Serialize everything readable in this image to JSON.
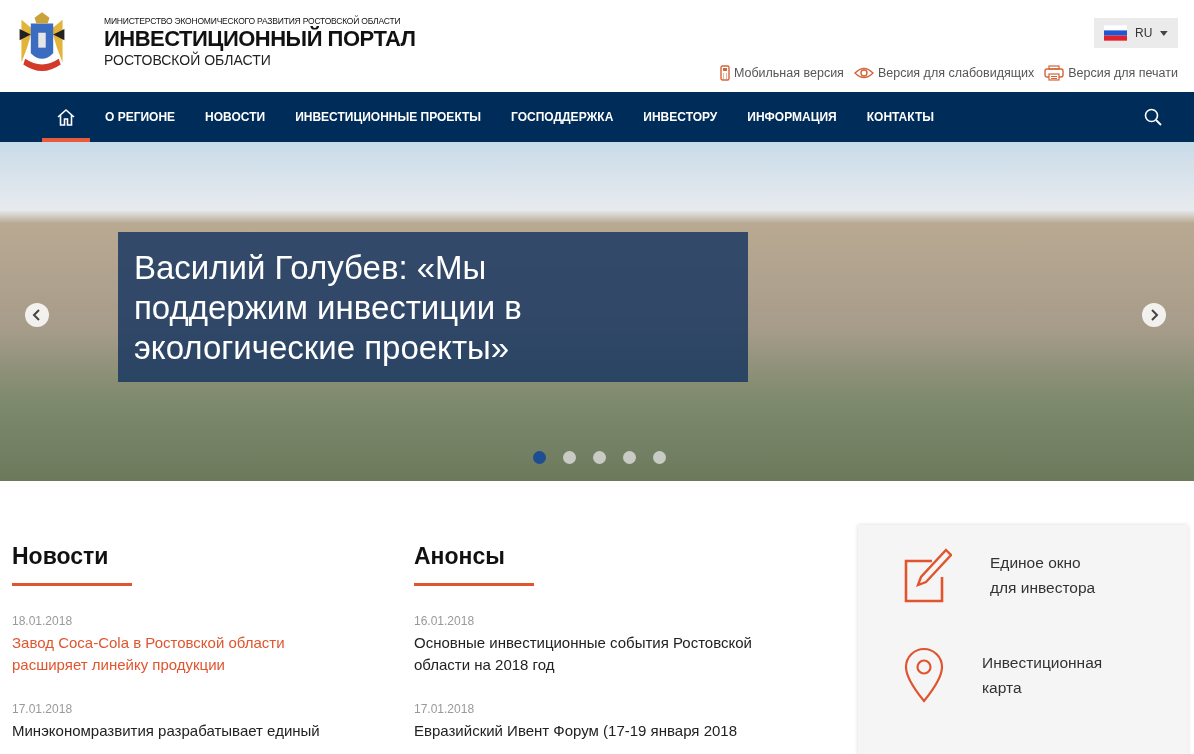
{
  "header": {
    "ministry": "МИНИСТЕРСТВО ЭКОНОМИЧЕСКОГО РАЗВИТИЯ РОСТОВСКОЙ ОБЛАСТИ",
    "title": "ИНВЕСТИЦИОННЫЙ ПОРТАЛ",
    "subtitle": "РОСТОВСКОЙ ОБЛАСТИ",
    "language": "RU",
    "links": [
      {
        "kind": "mobile",
        "label": "Мобильная версия"
      },
      {
        "kind": "eye",
        "label": "Версия для слабовидящих"
      },
      {
        "kind": "print",
        "label": "Версия для печати"
      }
    ]
  },
  "nav": [
    {
      "kind": "home",
      "selected": true
    },
    {
      "kind": "text",
      "label": "О РЕГИОНЕ",
      "selected": false
    },
    {
      "kind": "text",
      "label": "НОВОСТИ",
      "selected": false
    },
    {
      "kind": "text",
      "label": "ИНВЕСТИЦИОННЫЕ ПРОЕКТЫ",
      "selected": false
    },
    {
      "kind": "text",
      "label": "ГОСПОДДЕРЖКА",
      "selected": false
    },
    {
      "kind": "text",
      "label": "ИНВЕСТОРУ",
      "selected": false
    },
    {
      "kind": "text",
      "label": "ИНФОРМАЦИЯ",
      "selected": false
    },
    {
      "kind": "text",
      "label": "КОНТАКТЫ",
      "selected": false
    }
  ],
  "slider": {
    "caption": "Василий Голубев: «Мы поддержим инвестиции в экологические проекты»",
    "dots": [
      {
        "selected": true
      },
      {
        "selected": false
      },
      {
        "selected": false
      },
      {
        "selected": false
      },
      {
        "selected": false
      }
    ]
  },
  "columns": [
    {
      "title": "Новости",
      "items": [
        {
          "date": "18.01.2018",
          "text": "Завод Coca-Cola в Ростовской области расширяет линейку продукции",
          "hovered": true
        },
        {
          "date": "17.01.2018",
          "text": "Минэкономразвития разрабатывает единый",
          "hovered": false
        }
      ]
    },
    {
      "title": "Анонсы",
      "items": [
        {
          "date": "16.01.2018",
          "text": "Основные инвестиционные события Ростовской области на 2018 год",
          "hovered": false
        },
        {
          "date": "17.01.2018",
          "text": "Евразийский Ивент Форум (17-19 января 2018",
          "hovered": false
        }
      ]
    }
  ],
  "services": [
    {
      "kind": "pencil",
      "line1": "Единое окно",
      "line2": "для инвестора"
    },
    {
      "kind": "pin",
      "line1": "Инвестиционная",
      "line2": "карта"
    }
  ]
}
